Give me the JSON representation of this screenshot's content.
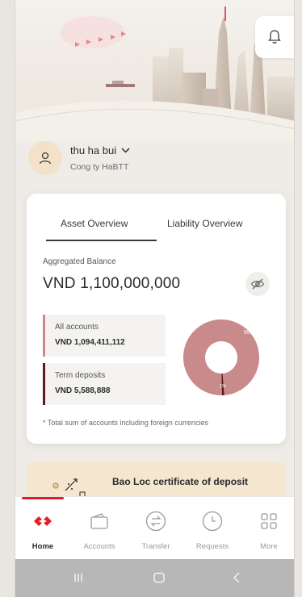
{
  "header": {
    "notification_icon": "bell-icon"
  },
  "profile": {
    "name": "thu ha bui",
    "company": "Cong ty HaBTT"
  },
  "overview": {
    "tabs": [
      {
        "label": "Asset Overview",
        "active": true
      },
      {
        "label": "Liability Overview",
        "active": false
      }
    ],
    "aggregated_label": "Aggregated Balance",
    "aggregated_value": "VND 1,100,000,000",
    "accounts": [
      {
        "label": "All accounts",
        "value": "VND 1,094,411,112",
        "color": "#c98a8c"
      },
      {
        "label": "Term deposits",
        "value": "VND 5,588,888",
        "color": "#5a1b21"
      }
    ],
    "chart_data": {
      "type": "pie",
      "categories": [
        "All accounts",
        "Term deposits"
      ],
      "values": [
        99,
        1
      ],
      "labels": [
        "99%",
        "1%"
      ],
      "colors": [
        "#c98a8c",
        "#5a1b21"
      ]
    },
    "note": "* Total sum of accounts including foreign currencies"
  },
  "promo": {
    "title": "Bao Loc certificate of deposit"
  },
  "nav": {
    "items": [
      {
        "label": "Home",
        "icon": "techcombank-logo-icon",
        "active": true
      },
      {
        "label": "Accounts",
        "icon": "wallet-icon",
        "active": false
      },
      {
        "label": "Transfer",
        "icon": "transfer-icon",
        "active": false
      },
      {
        "label": "Requests",
        "icon": "clock-icon",
        "active": false
      },
      {
        "label": "More",
        "icon": "grid-icon",
        "active": false
      }
    ]
  },
  "colors": {
    "brand_red": "#e31e26",
    "accent_rose": "#c98a8c",
    "accent_maroon": "#5a1b21"
  }
}
